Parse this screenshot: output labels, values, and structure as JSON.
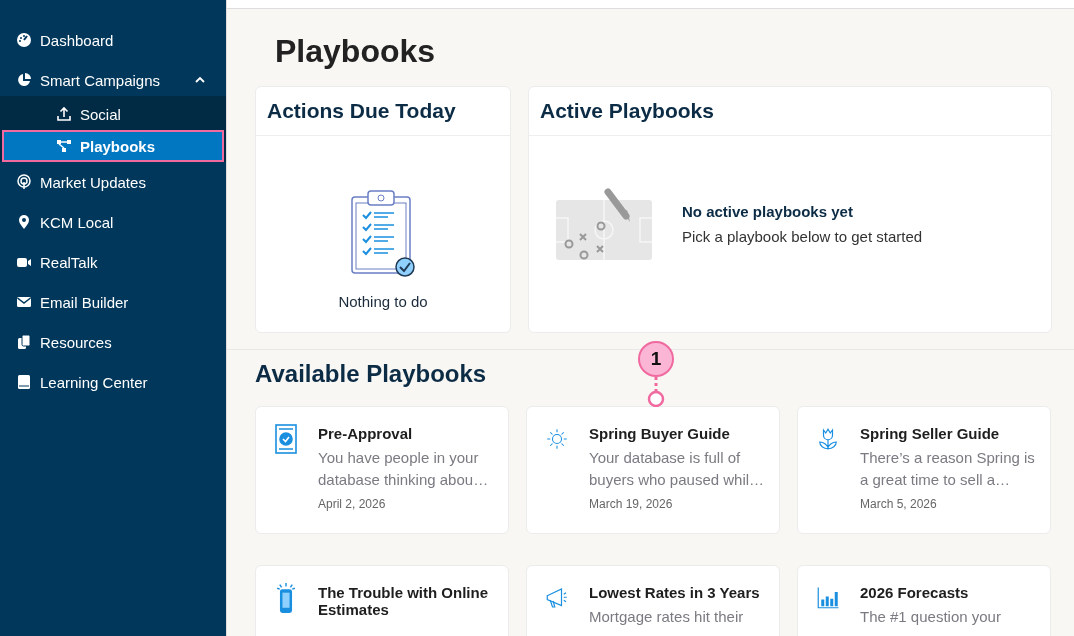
{
  "sidebar": {
    "items": [
      {
        "label": "Dashboard",
        "selected": false
      },
      {
        "label": "Smart Campaigns",
        "selected": false,
        "expanded": true,
        "children": [
          {
            "label": "Social",
            "selected": false,
            "outlined": false
          },
          {
            "label": "Playbooks",
            "selected": true,
            "outlined": true
          }
        ]
      },
      {
        "label": "Market Updates",
        "selected": false
      },
      {
        "label": "KCM Local",
        "selected": false
      },
      {
        "label": "RealTalk",
        "selected": false
      },
      {
        "label": "Email Builder",
        "selected": false
      },
      {
        "label": "Resources",
        "selected": false
      },
      {
        "label": "Learning Center",
        "selected": false
      }
    ]
  },
  "page": {
    "title": "Playbooks"
  },
  "actions_due": {
    "title": "Actions Due Today",
    "empty_text": "Nothing to do"
  },
  "active_playbooks": {
    "title": "Active Playbooks",
    "empty_title": "No active playbooks yet",
    "empty_text": "Pick a playbook below to get started"
  },
  "available": {
    "title": "Available Playbooks",
    "cards": [
      {
        "title": "Pre-Approval",
        "description": "You have people in your database thinking abou…",
        "date": "April 2, 2026"
      },
      {
        "title": "Spring Buyer Guide",
        "description": "Your database is full of buyers who paused whil…",
        "date": "March 19, 2026"
      },
      {
        "title": "Spring Seller Guide",
        "description": "There’s a reason Spring is a great time to sell a…",
        "date": "March 5, 2026"
      },
      {
        "title": "The Trouble with Online Estimates"
      },
      {
        "title": "Lowest Rates in 3 Years",
        "description": "Mortgage rates hit their"
      },
      {
        "title": "2026 Forecasts",
        "description": "The #1 question your"
      }
    ]
  },
  "callout": {
    "number": "1"
  }
}
